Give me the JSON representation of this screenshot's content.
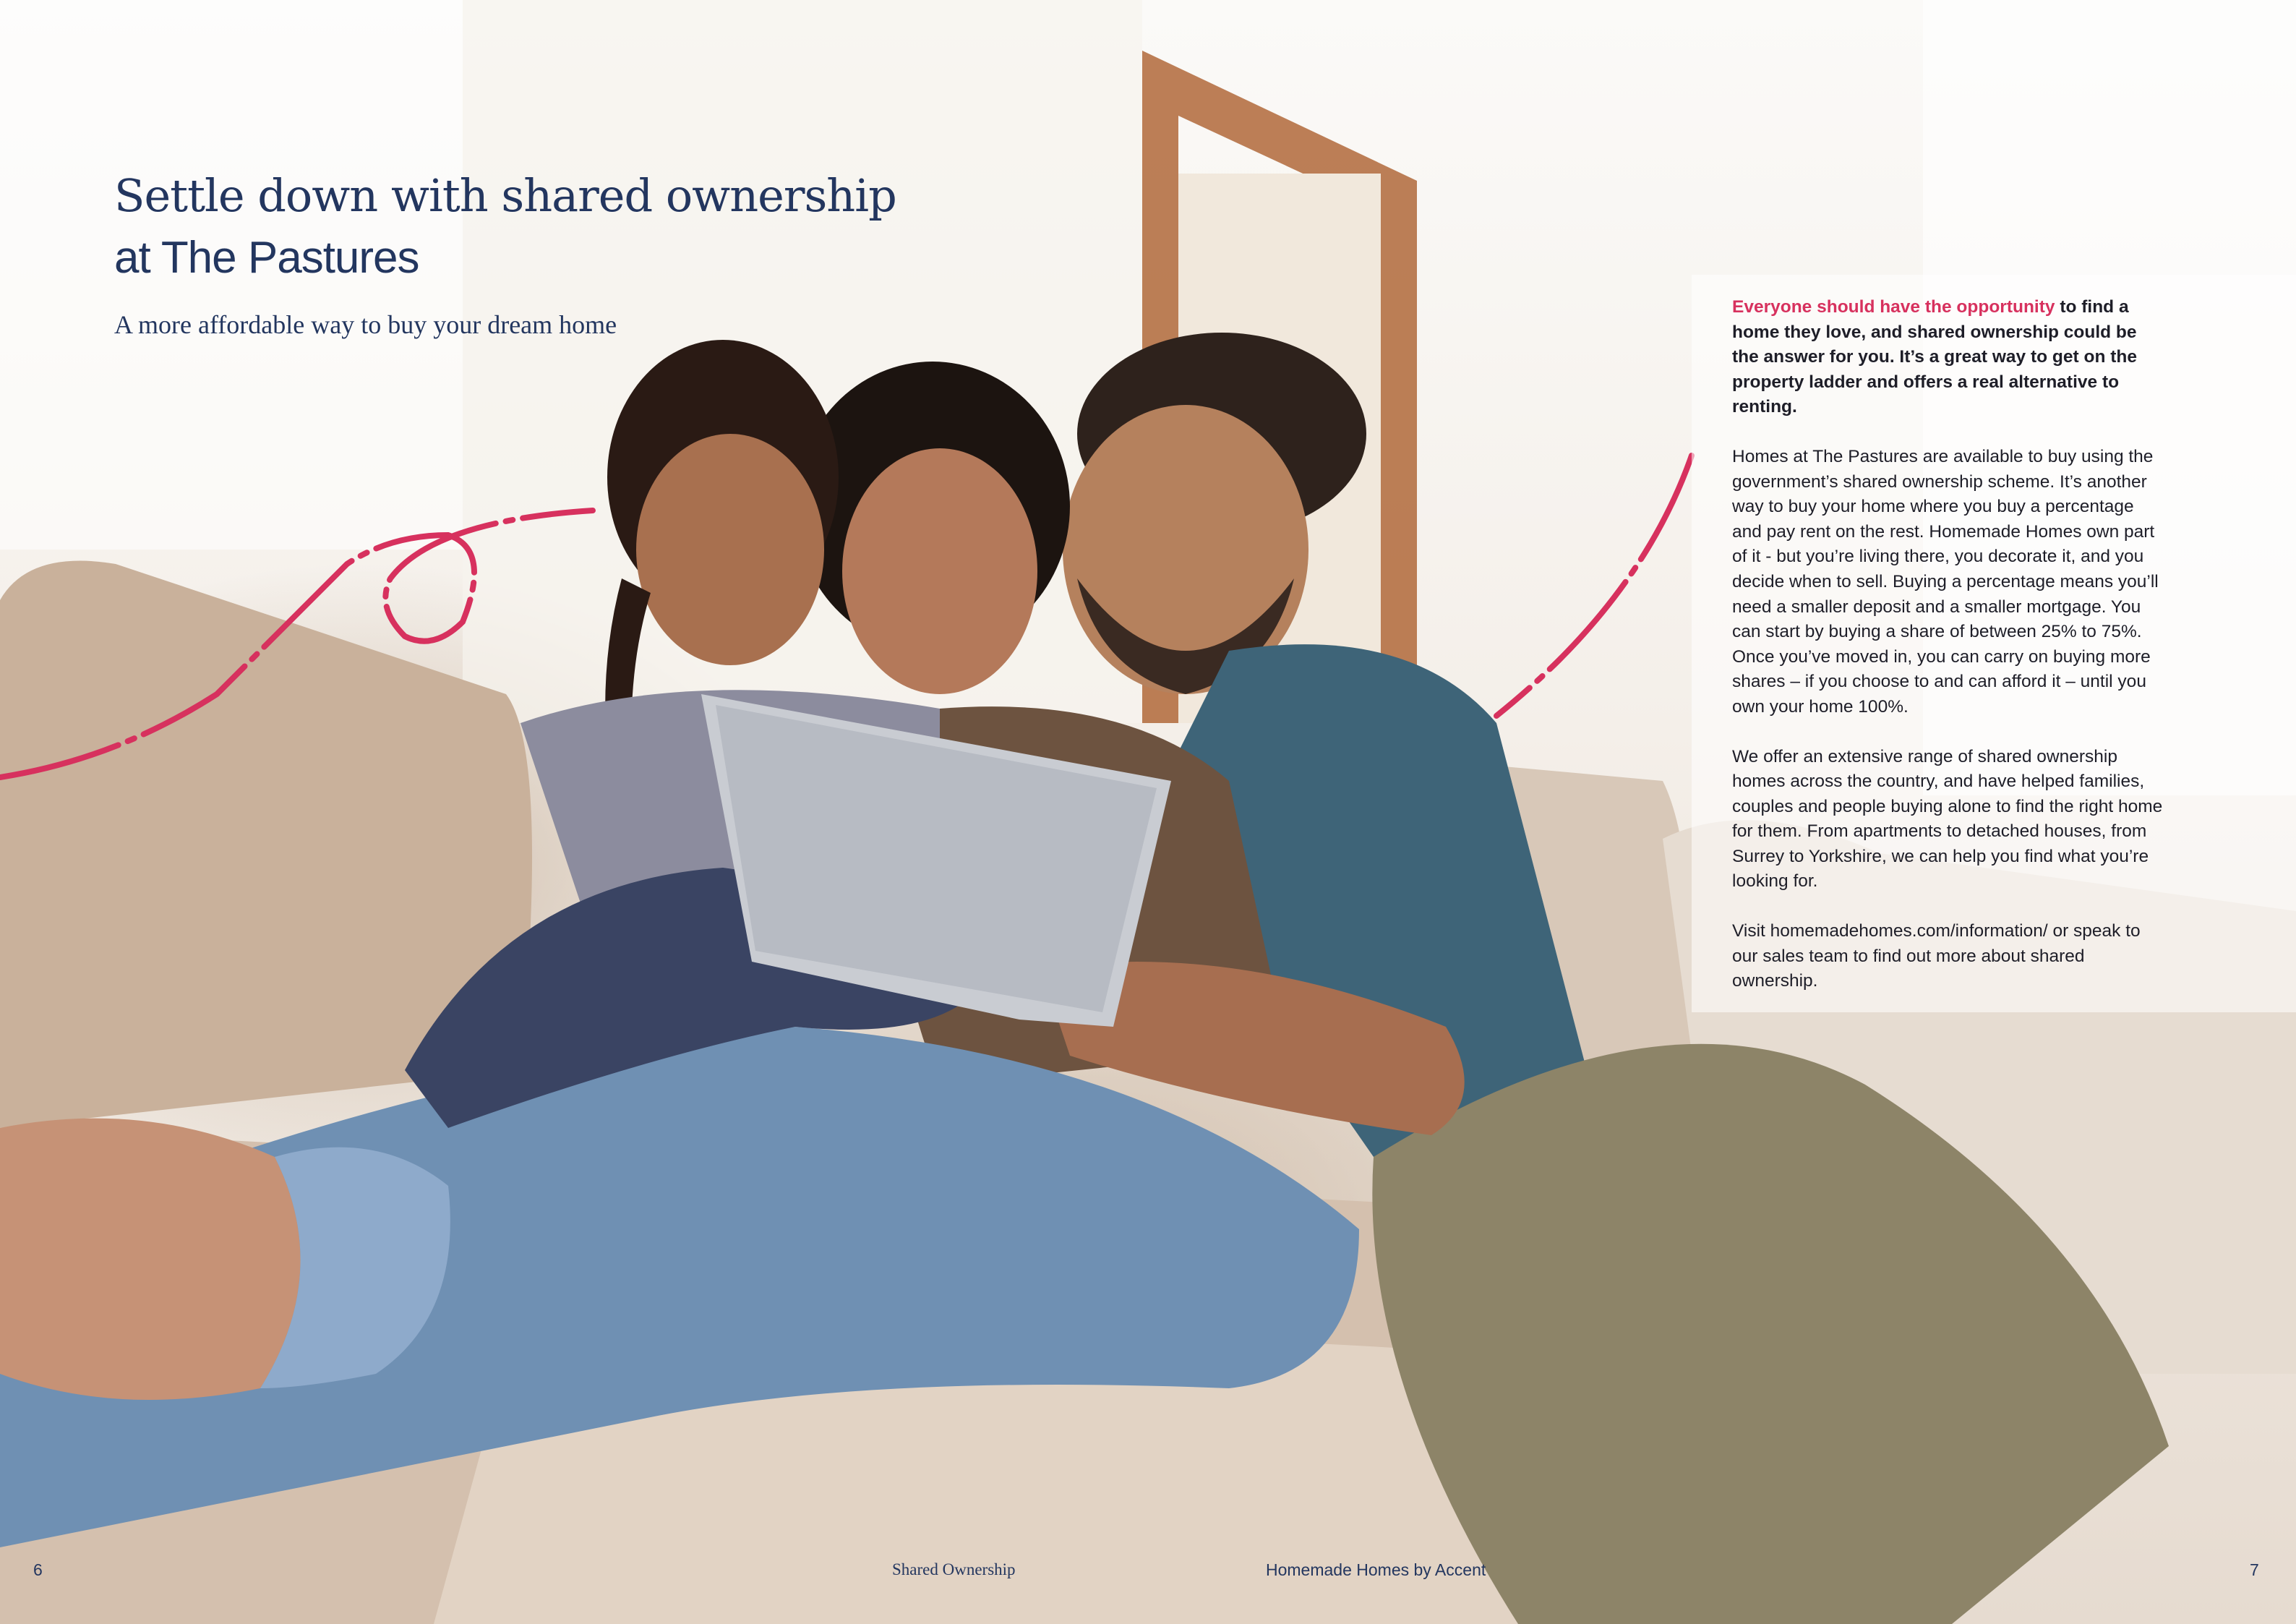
{
  "headline": {
    "line1": "Settle down with shared ownership",
    "line2": "at The Pastures"
  },
  "subheading": "A more affordable way to buy your dream home",
  "body": {
    "intro_highlight": "Everyone should have the opportunity",
    "intro_rest": " to find a home they love, and shared ownership could be the answer for you. It’s a great way to get on the property ladder and offers a real alternative to renting.",
    "paragraph_2": "Homes at The Pastures are available to buy using the government’s shared ownership scheme. It’s another way to buy your home where you buy a percentage and pay rent on the rest. Homemade Homes own part of it - but you’re living there, you decorate it, and you decide when to sell. Buying a percentage means you’ll need a smaller deposit and a smaller mortgage. You can start by buying a share of between 25% to 75%. Once you’ve moved in, you can carry on buying more shares – if you choose to and can afford it – until you own your home 100%.",
    "paragraph_3": "We offer an extensive range of shared ownership homes across the country, and have helped families, couples and people buying alone to find the right home for them. From apartments to detached houses, from Surrey to Yorkshire, we can help you find what you’re looking for.",
    "paragraph_4": "Visit homemadehomes.com/information/ or speak to our sales team to find out more about shared ownership."
  },
  "footer": {
    "page_left": "6",
    "section_label": "Shared Ownership",
    "brand_label": "Homemade Homes by Accent",
    "page_right": "7"
  },
  "colors": {
    "navy": "#23365f",
    "accent_pink": "#d7315e",
    "body_text": "#1e1e28"
  }
}
